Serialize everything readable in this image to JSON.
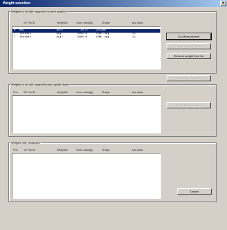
{
  "window": {
    "title": "Weight selection",
    "close_glyph": "×"
  },
  "columns_main": [
    "S/T SerID",
    "WeightID",
    "Nom. value[g]",
    "Shape",
    "Acc.class"
  ],
  "columns_pos": [
    "Pos",
    "S/T SerID",
    "WeightID",
    "Nom. value[g]",
    "Shape",
    "Acc.class"
  ],
  "group1": {
    "legend": "Weights to do with magnet in current position",
    "rows": [
      {
        "pos": "0",
        "serid": "MRI",
        "weightid": "10/1",
        "nom": "10.0",
        "shape": "Cal0mm",
        "acc": "",
        "selected": true
      },
      {
        "pos": "T",
        "serid": "TestSet",
        "weightid": "1kg",
        "nom": "1000.0",
        "shape": "OIML-1kg",
        "acc": "E1",
        "selected": false
      },
      {
        "pos": "T",
        "serid": "TestSet",
        "weightid": "1kg*",
        "nom": "1000.0",
        "shape": "OIML-1kg",
        "acc": "E1",
        "selected": false
      }
    ]
  },
  "group2": {
    "legend": "Weights to do with magnet turned upside down",
    "rows": []
  },
  "group3": {
    "legend": "Weights fully measured",
    "rows": []
  },
  "buttons": {
    "do_measurement": "Do Measurement",
    "change_weight_pos": "Change Weight Position",
    "remove_weight": "Remove weight from list",
    "turn_magnet": "Turn Magnet upside",
    "redo_measurement": "Redo Measurement",
    "cancel": "Cancel"
  }
}
